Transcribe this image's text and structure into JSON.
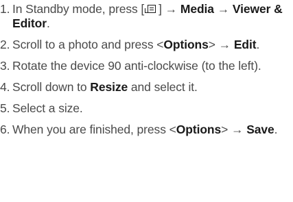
{
  "steps": [
    {
      "num": "1.",
      "t1": "In Standby mode, press [",
      "icon": "menu-key-icon",
      "t2": "] → ",
      "b1": "Media",
      "t3": " → ",
      "b2": "Viewer & Editor",
      "t4": "."
    },
    {
      "num": "2.",
      "t1": "Scroll to a photo and press <",
      "b1": "Options",
      "t2": "> → ",
      "b2": "Edit",
      "t3": "."
    },
    {
      "num": "3.",
      "text": "Rotate the device 90 anti-clockwise (to the left)."
    },
    {
      "num": "4.",
      "t1": "Scroll down to ",
      "b1": "Resize",
      "t2": " and select it."
    },
    {
      "num": "5.",
      "text": "Select a size."
    },
    {
      "num": "6.",
      "t1": "When you are finished, press <",
      "b1": "Options",
      "t2": "> → ",
      "b2": "Save",
      "t3": "."
    }
  ]
}
